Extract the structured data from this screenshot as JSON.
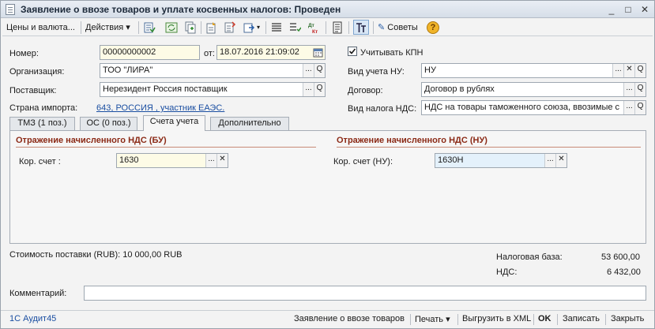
{
  "window": {
    "title": "Заявление о ввозе товаров и уплате косвенных налогов: Проведен",
    "minimize": "_",
    "maximize": "□",
    "close": "✕"
  },
  "toolbar": {
    "prices_currency": "Цены и валюта...",
    "actions": "Действия",
    "advice": "Советы",
    "dropdown_arrow": "▾"
  },
  "form": {
    "number_label": "Номер:",
    "number_value": "00000000002",
    "date_label": "от:",
    "date_value": "18.07.2016 21:09:02",
    "kpn_label": "Учитывать КПН",
    "org_label": "Организация:",
    "org_value": "ТОО \"ЛИРА\"",
    "supplier_label": "Поставщик:",
    "supplier_value": "Нерезидент Россия поставщик",
    "country_label": "Страна импорта:",
    "country_value": "643, РОССИЯ , участник ЕАЭС.",
    "nu_label": "Вид учета НУ:",
    "nu_value": "НУ",
    "contract_label": "Договор:",
    "contract_value": "Договор в рублях",
    "vat_kind_label": "Вид налога НДС:",
    "vat_kind_value": "НДС на товары таможенного союза, ввозимые с"
  },
  "buttons": {
    "select": "...",
    "clear": "✕",
    "open": "Q"
  },
  "tabs": [
    {
      "label": "ТМЗ (1 поз.)"
    },
    {
      "label": "ОС (0 поз.)"
    },
    {
      "label": "Счета учета"
    },
    {
      "label": "Дополнительно"
    }
  ],
  "accounts": {
    "bu_title": "Отражение начисленного НДС (БУ)",
    "bu_label": "Кор. счет :",
    "bu_value": "1630",
    "nu_title": "Отражение начисленного НДС (НУ)",
    "nu_label": "Кор. счет (НУ):",
    "nu_value": "1630Н"
  },
  "totals": {
    "cost_text": "Стоимость поставки (RUB): 10 000,00 RUB",
    "tax_base_label": "Налоговая база:",
    "tax_base_value": "53 600,00",
    "vat_label": "НДС:",
    "vat_value": "6 432,00"
  },
  "comment": {
    "label": "Комментарий:",
    "value": ""
  },
  "statusbar": {
    "app": "1С Аудит45",
    "declaration": "Заявление о ввозе товаров",
    "print": "Печать",
    "export_xml": "Выгрузить в XML",
    "ok": "OK",
    "save": "Записать",
    "close": "Закрыть"
  }
}
